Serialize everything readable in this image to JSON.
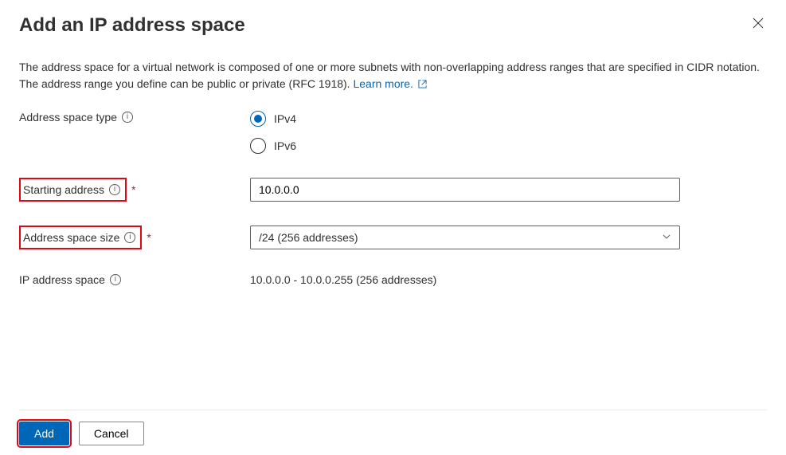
{
  "header": {
    "title": "Add an IP address space"
  },
  "intro": {
    "text": "The address space for a virtual network is composed of one or more subnets with non-overlapping address ranges that are specified in CIDR notation. The address range you define can be public or private (RFC 1918).",
    "learn_more": "Learn more."
  },
  "labels": {
    "address_space_type": "Address space type",
    "starting_address": "Starting address",
    "address_space_size": "Address space size",
    "ip_address_space": "IP address space"
  },
  "radios": {
    "ipv4": "IPv4",
    "ipv6": "IPv6",
    "selected": "ipv4"
  },
  "fields": {
    "starting_address_value": "10.0.0.0",
    "address_space_size_value": "/24 (256 addresses)",
    "ip_address_space_value": "10.0.0.0 - 10.0.0.255 (256 addresses)"
  },
  "footer": {
    "add": "Add",
    "cancel": "Cancel"
  }
}
